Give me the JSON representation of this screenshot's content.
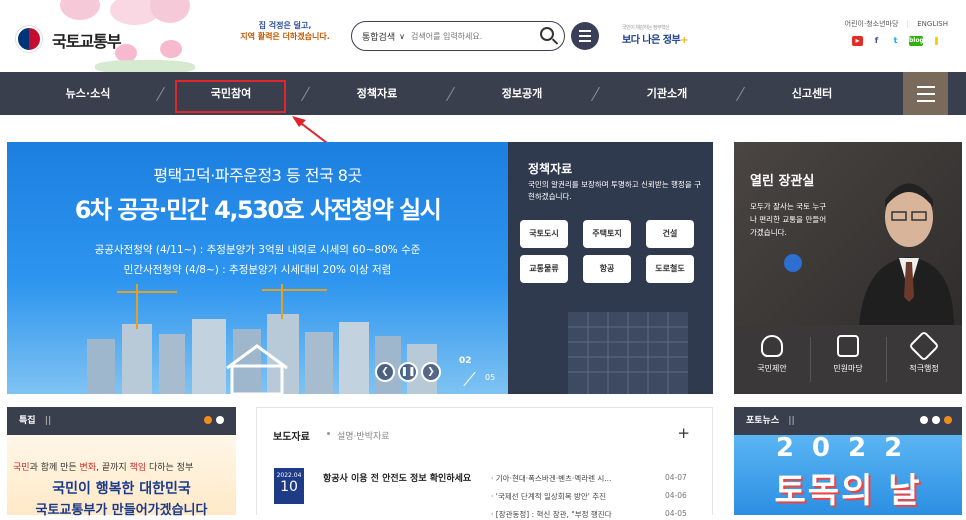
{
  "header": {
    "logo_text": "국토교통부",
    "slogan_line1": "집 걱정은 덜고,",
    "slogan_line2": "지역 활력은 더하겠습니다.",
    "search": {
      "category": "통합검색",
      "placeholder": "검색어를 입력하세요."
    },
    "better_gov": "보다 나은 정부",
    "better_gov_sub": "국민이 체감하는 정부혁신",
    "util_links": [
      "어린이·청소년마당",
      "ENGLISH"
    ],
    "sns": [
      "youtube-icon",
      "facebook-icon",
      "twitter-icon",
      "blog-icon",
      "kakao-icon"
    ]
  },
  "nav": {
    "items": [
      "뉴스·소식",
      "국민참여",
      "정책자료",
      "정보공개",
      "기관소개",
      "신고센터"
    ],
    "highlighted": "국민참여"
  },
  "banner": {
    "title1": "평택고덕·파주운정3 등 전국 8곳",
    "title2": "6차 공공·민간 4,530호 사전청약 실시",
    "line1": "공공사전청약 (4/11~) : 추정분양가 3억원 내외로 시세의 60~80% 수준",
    "line2": "민간사전청약 (4/8~) : 추정분양가 시세대비 20% 이상 저렴",
    "page_current": "02",
    "page_total": "05"
  },
  "policy": {
    "title": "정책자료",
    "desc": "국민의 알권리를 보장하며 투명하고 신뢰받는 행정을 구현하겠습니다.",
    "buttons": [
      "국토도시",
      "주택토지",
      "건설",
      "교통물류",
      "항공",
      "도로철도"
    ]
  },
  "minister": {
    "title": "열린 장관실",
    "desc": "모두가 잘사는 국토 누구나 편리한 교통을 만들어가겠습니다.",
    "items": [
      "국민제안",
      "민원마당",
      "적극행정"
    ]
  },
  "special": {
    "head": "특집",
    "line1_a": "국민",
    "line1_b": "과 함께 만든 ",
    "line1_c": "변화",
    "line1_d": ", 끝까지 ",
    "line1_e": "책임",
    "line1_f": " 다하는 정부",
    "line2": "국민이 행복한 대한민국",
    "line3": "국토교통부가 만들어가겠습니다"
  },
  "press": {
    "tab_active": "보도자료",
    "tab_inactive": "설명·반박자료",
    "date_ym": "2022.04",
    "date_d": "10",
    "main_title": "항공사 이용 전 안전도 정보 확인하세요",
    "items": [
      {
        "title": "· 기아·현대·폭스바겐·벤츠·멕라렌 시...",
        "date": "04-07"
      },
      {
        "title": "· '국제선 단계적 일상회복 방안' 추진",
        "date": "04-06"
      },
      {
        "title": "· [장관동정] : 혁신 장관, \"부정 행진다",
        "date": "04-05"
      }
    ]
  },
  "photo": {
    "head": "포토뉴스",
    "year": "2022",
    "text": "토목의 날"
  },
  "colors": {
    "nav_bg": "#3a3f4d",
    "highlight": "#e0262c",
    "banner_blue": "#1c7fe0",
    "policy_bg": "#2f3a4f",
    "brand_navy": "#1e3b88"
  }
}
